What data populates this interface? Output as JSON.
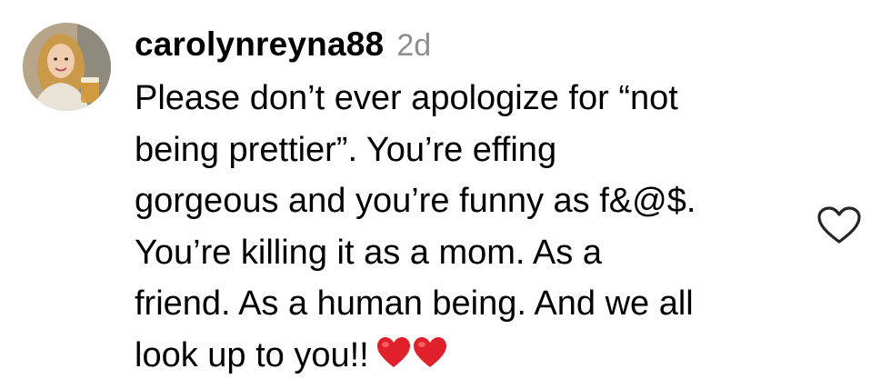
{
  "comment": {
    "username": "carolynreyna88",
    "timestamp": "2d",
    "text_lines": [
      "Please don’t ever apologize for “not",
      "being prettier”. You’re effing",
      "gorgeous and you’re funny as f&@$.",
      "You’re killing it as a mom. As a",
      "friend. As a human being. And we all",
      "look up to you!!"
    ],
    "trailing_emoji": [
      "red-heart",
      "red-heart"
    ],
    "avatar_icon": "user-avatar-photo",
    "like_icon": "heart-outline-icon",
    "colors": {
      "text": "#000000",
      "timestamp": "#8e8e8e",
      "like_icon": "#262626",
      "heart_emoji": "#e0202a"
    }
  }
}
